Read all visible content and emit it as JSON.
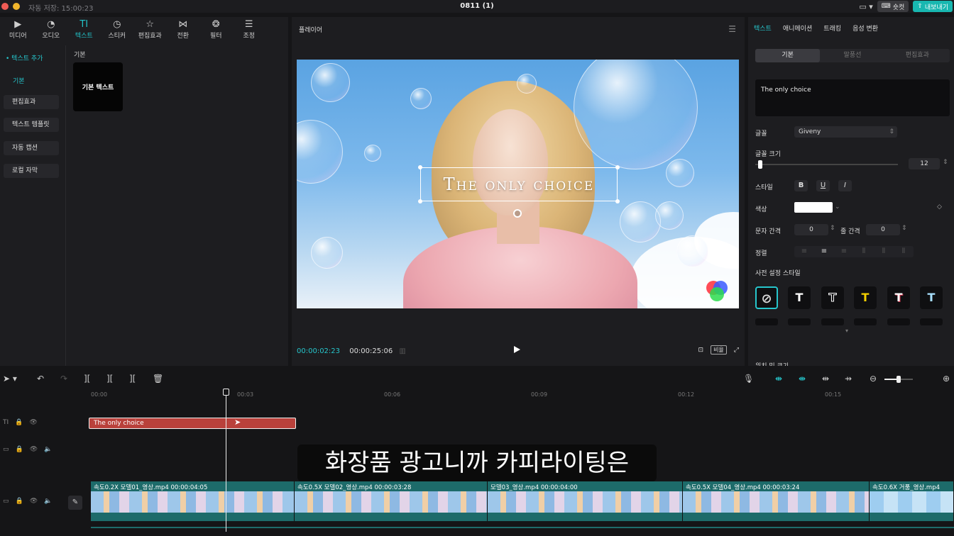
{
  "titlebar": {
    "autosave": "자동 저장: 15:00:23",
    "title": "0811 (1)",
    "shortcut": "숏컷",
    "export": "내보내기"
  },
  "toolbar": [
    {
      "label": "미디어",
      "icon": "media-icon"
    },
    {
      "label": "오디오",
      "icon": "audio-icon"
    },
    {
      "label": "텍스트",
      "icon": "text-icon",
      "active": true
    },
    {
      "label": "스티커",
      "icon": "sticker-icon"
    },
    {
      "label": "편집효과",
      "icon": "effects-icon"
    },
    {
      "label": "전환",
      "icon": "transition-icon"
    },
    {
      "label": "필터",
      "icon": "filter-icon"
    },
    {
      "label": "조정",
      "icon": "adjust-icon"
    }
  ],
  "sidenav": {
    "header": "• 텍스트 추가",
    "sub": "기본",
    "items": [
      "편집효과",
      "텍스트 템플릿",
      "자동 캡션",
      "로컬 자막"
    ]
  },
  "library": {
    "category": "기본",
    "card": "기본 텍스트"
  },
  "player": {
    "title": "플레이어",
    "overlay_text": "The only choice",
    "current_time": "00:00:02:23",
    "total_time": "00:00:25:06",
    "ratio": "비율"
  },
  "inspector": {
    "tabs": [
      "텍스트",
      "애니메이션",
      "트래킹",
      "음성 변환"
    ],
    "subtabs": [
      "기본",
      "말풍선",
      "편집효과"
    ],
    "text_value": "The only choice",
    "font_label": "글꼴",
    "font_value": "Giveny",
    "size_label": "글꼴 크기",
    "size_value": "12",
    "size_level": 0.05,
    "style_label": "스타일",
    "style_buttons": [
      "B",
      "U",
      "I"
    ],
    "color_label": "색상",
    "color_value": "#ffffff",
    "spacing_label": "문자 간격",
    "spacing_value": "0",
    "line_label": "줄 간격",
    "line_value": "0",
    "align_label": "정렬",
    "preset_label": "사전 설정 스타일",
    "presets": [
      {
        "glyph": "⃠",
        "color": "#dddddd"
      },
      {
        "glyph": "T",
        "color": "#ffffff"
      },
      {
        "glyph": "T",
        "color": "#ffffff"
      },
      {
        "glyph": "T",
        "color": "#f5d000"
      },
      {
        "glyph": "T",
        "color": "#ffffff"
      },
      {
        "glyph": "T",
        "color": "#a8e0ff"
      }
    ],
    "more_label": "위치 및 크기"
  },
  "timeline": {
    "ruler": [
      "00:00",
      "00:03",
      "00:06",
      "00:09",
      "00:12",
      "00:15"
    ],
    "text_clip": "The only choice",
    "subtitle": "화장품 광고니까 카피라이팅은",
    "video_clips": [
      {
        "label": "속도0.2X  모델01_영상.mp4   00:00:04:05"
      },
      {
        "label": "속도0.5X  모델02_영상.mp4   00:00:03:28"
      },
      {
        "label": "모델03_영상.mp4   00:00:04:00"
      },
      {
        "label": "속도0.5X  모델04_영상.mp4   00:00:03:24"
      },
      {
        "label": "속도0.6X  거품_영상.mp4"
      }
    ]
  },
  "colors": {
    "accent": "#26c6cc",
    "clip_text": "#b9413b",
    "clip_video": "#1d6b6a"
  }
}
